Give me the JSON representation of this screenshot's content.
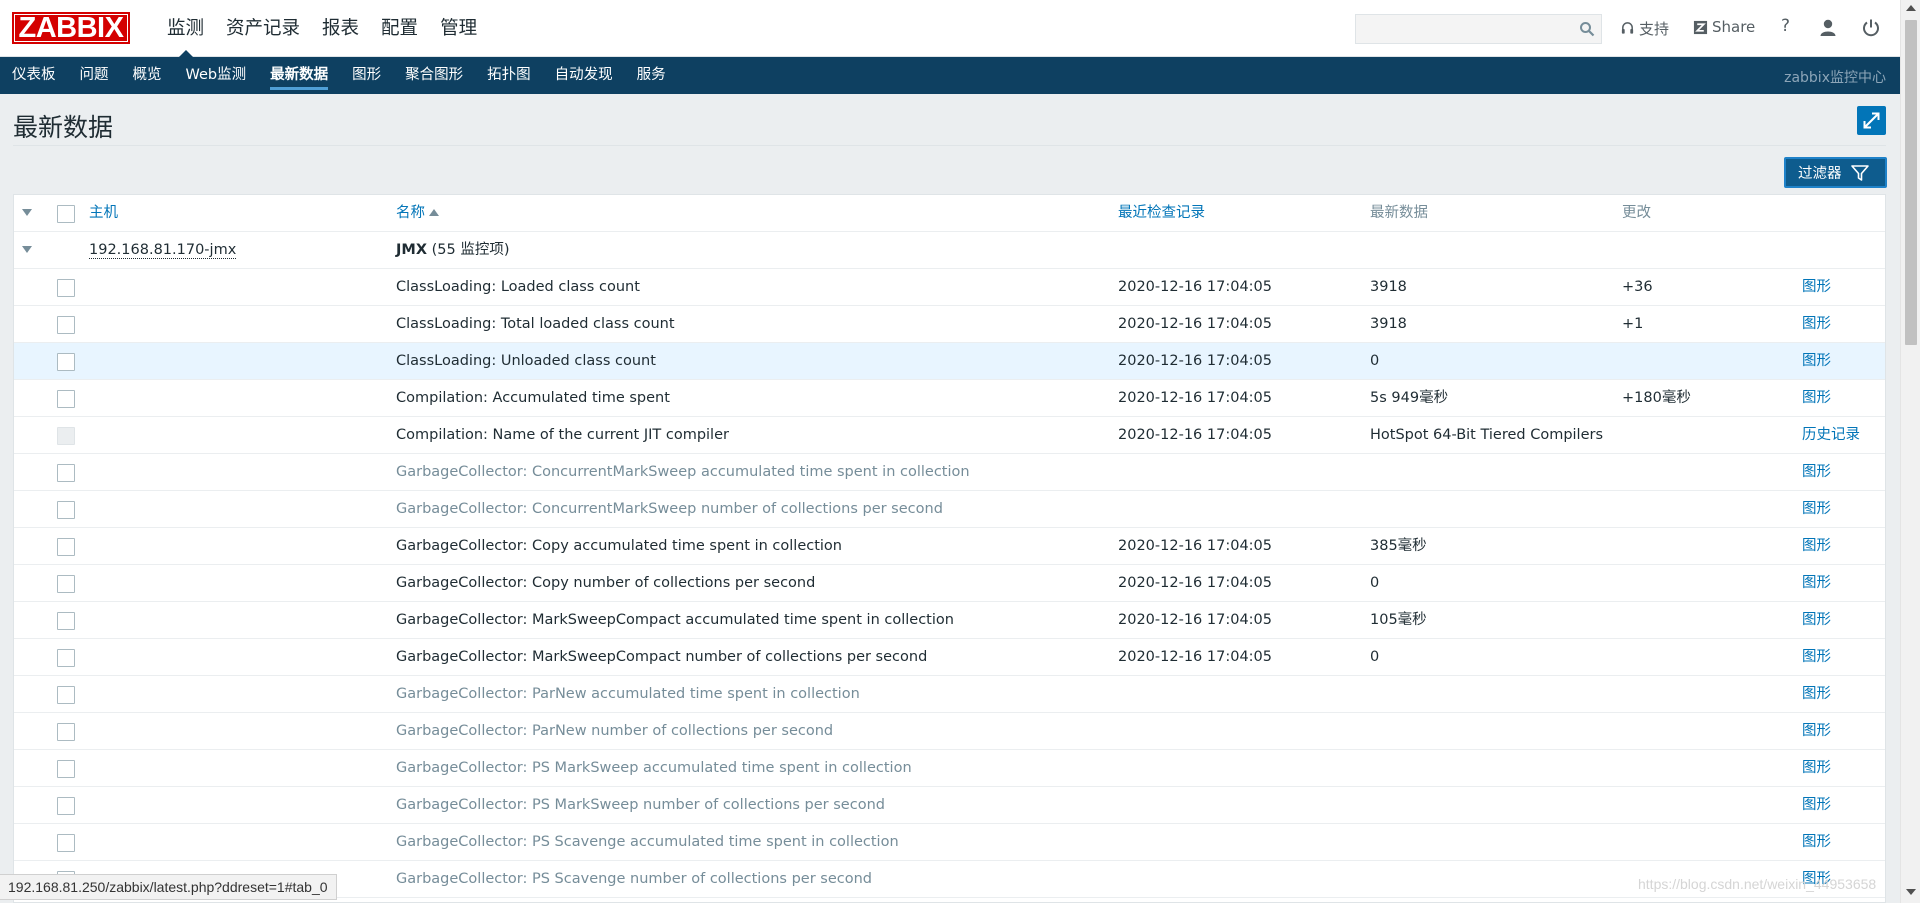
{
  "header": {
    "logo": "ZABBIX",
    "menu": [
      "监测",
      "资产记录",
      "报表",
      "配置",
      "管理"
    ],
    "search_placeholder": "",
    "support_label": "支持",
    "share_label": "Share",
    "help_label": "?"
  },
  "subnav": {
    "items": [
      "仪表板",
      "问题",
      "概览",
      "Web监测",
      "最新数据",
      "图形",
      "聚合图形",
      "拓扑图",
      "自动发现",
      "服务"
    ],
    "server_name": "zabbix监控中心"
  },
  "page": {
    "title": "最新数据",
    "filter_label": "过滤器"
  },
  "table": {
    "headers": {
      "host": "主机",
      "name": "名称",
      "last_check": "最近检查记录",
      "last_value": "最新数据",
      "change": "更改"
    },
    "group": {
      "host": "192.168.81.170-jmx",
      "app": "JMX",
      "count": "(55 监控项)"
    },
    "rows": [
      {
        "name": "ClassLoading: Loaded class count",
        "time": "2020-12-16 17:04:05",
        "value": "3918",
        "change": "+36",
        "action": "图形",
        "dim": false,
        "cb_disabled": false
      },
      {
        "name": "ClassLoading: Total loaded class count",
        "time": "2020-12-16 17:04:05",
        "value": "3918",
        "change": "+1",
        "action": "图形",
        "dim": false,
        "cb_disabled": false
      },
      {
        "name": "ClassLoading: Unloaded class count",
        "time": "2020-12-16 17:04:05",
        "value": "0",
        "change": "",
        "action": "图形",
        "dim": false,
        "cb_disabled": false
      },
      {
        "name": "Compilation: Accumulated time spent",
        "time": "2020-12-16 17:04:05",
        "value": "5s 949毫秒",
        "change": "+180毫秒",
        "action": "图形",
        "dim": false,
        "cb_disabled": false
      },
      {
        "name": "Compilation: Name of the current JIT compiler",
        "time": "2020-12-16 17:04:05",
        "value": "HotSpot 64-Bit Tiered Compilers",
        "change": "",
        "action": "历史记录",
        "dim": false,
        "cb_disabled": true
      },
      {
        "name": "GarbageCollector: ConcurrentMarkSweep accumulated time spent in collection",
        "time": "",
        "value": "",
        "change": "",
        "action": "图形",
        "dim": true,
        "cb_disabled": false
      },
      {
        "name": "GarbageCollector: ConcurrentMarkSweep number of collections per second",
        "time": "",
        "value": "",
        "change": "",
        "action": "图形",
        "dim": true,
        "cb_disabled": false
      },
      {
        "name": "GarbageCollector: Copy accumulated time spent in collection",
        "time": "2020-12-16 17:04:05",
        "value": "385毫秒",
        "change": "",
        "action": "图形",
        "dim": false,
        "cb_disabled": false
      },
      {
        "name": "GarbageCollector: Copy number of collections per second",
        "time": "2020-12-16 17:04:05",
        "value": "0",
        "change": "",
        "action": "图形",
        "dim": false,
        "cb_disabled": false
      },
      {
        "name": "GarbageCollector: MarkSweepCompact accumulated time spent in collection",
        "time": "2020-12-16 17:04:05",
        "value": "105毫秒",
        "change": "",
        "action": "图形",
        "dim": false,
        "cb_disabled": false
      },
      {
        "name": "GarbageCollector: MarkSweepCompact number of collections per second",
        "time": "2020-12-16 17:04:05",
        "value": "0",
        "change": "",
        "action": "图形",
        "dim": false,
        "cb_disabled": false
      },
      {
        "name": "GarbageCollector: ParNew accumulated time spent in collection",
        "time": "",
        "value": "",
        "change": "",
        "action": "图形",
        "dim": true,
        "cb_disabled": false
      },
      {
        "name": "GarbageCollector: ParNew number of collections per second",
        "time": "",
        "value": "",
        "change": "",
        "action": "图形",
        "dim": true,
        "cb_disabled": false
      },
      {
        "name": "GarbageCollector: PS MarkSweep accumulated time spent in collection",
        "time": "",
        "value": "",
        "change": "",
        "action": "图形",
        "dim": true,
        "cb_disabled": false
      },
      {
        "name": "GarbageCollector: PS MarkSweep number of collections per second",
        "time": "",
        "value": "",
        "change": "",
        "action": "图形",
        "dim": true,
        "cb_disabled": false
      },
      {
        "name": "GarbageCollector: PS Scavenge accumulated time spent in collection",
        "time": "",
        "value": "",
        "change": "",
        "action": "图形",
        "dim": true,
        "cb_disabled": false
      },
      {
        "name": "GarbageCollector: PS Scavenge number of collections per second",
        "time": "",
        "value": "",
        "change": "",
        "action": "图形",
        "dim": true,
        "cb_disabled": false
      }
    ]
  },
  "statusbar": {
    "url": "192.168.81.250/zabbix/latest.php?ddreset=1#tab_0",
    "watermark": "https://blog.csdn.net/weixin_44953658"
  },
  "colors": {
    "brand": "#d40000",
    "subnav": "#0e4061",
    "link": "#0275b8"
  }
}
